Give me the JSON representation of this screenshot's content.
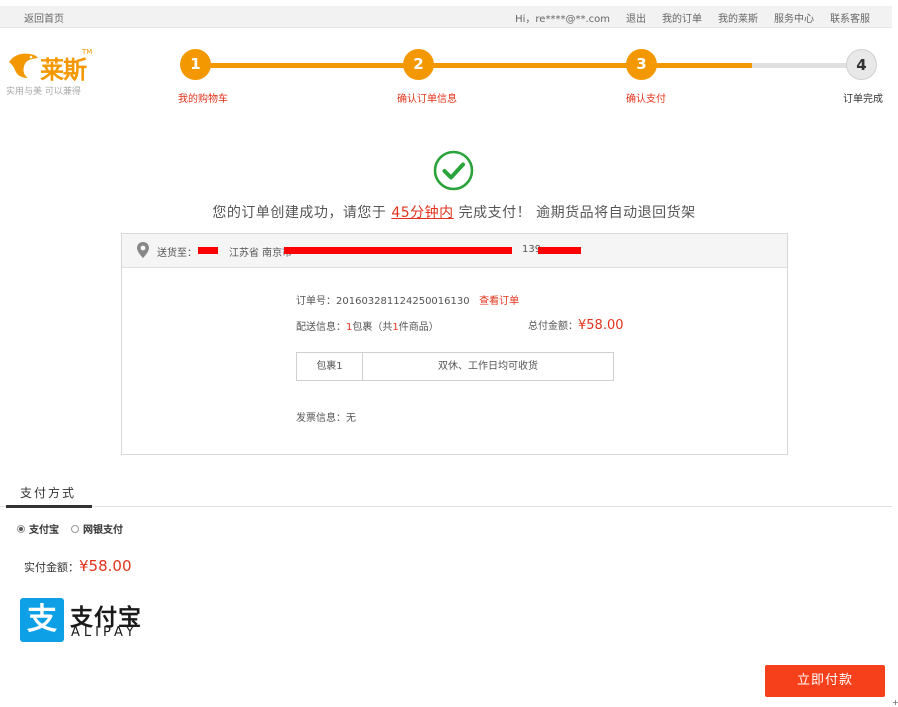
{
  "topbar": {
    "home": "返回首页",
    "greeting": "Hi，",
    "user": "re****@**.com",
    "links": [
      "退出",
      "我的订单",
      "我的莱斯",
      "服务中心",
      "联系客服"
    ]
  },
  "logo": {
    "brand": "莱斯",
    "tm": "TM",
    "slogan": "实用与美 可以兼得"
  },
  "steps": [
    {
      "num": "1",
      "label": "我的购物车"
    },
    {
      "num": "2",
      "label": "确认订单信息"
    },
    {
      "num": "3",
      "label": "确认支付"
    },
    {
      "num": "4",
      "label": "订单完成"
    }
  ],
  "colors": {
    "accent": "#f39800",
    "inactive": "#e0e0e0",
    "red": "#e3331c",
    "success": "#2aa33a",
    "button": "#f5401b",
    "alipay_blue": "#0ea0e6"
  },
  "success": {
    "before": "您的订单创建成功，请您于",
    "limit": "45分钟内",
    "after": "完成支付！ 逾期货品将自动退回货架"
  },
  "order": {
    "ship_label": "送货至：",
    "address": "江苏省 南京市",
    "phone_prefix": "139",
    "order_no_label": "订单号：",
    "order_no": "20160328112425001613​0",
    "view_order": "查看订单",
    "delivery_label": "配送信息：",
    "delivery_count": "1",
    "delivery_mid": "包裹（共",
    "delivery_items": "1",
    "delivery_end": "件商品）",
    "total_label": "总付金额：",
    "total": "¥58.00",
    "package_name": "包裹1",
    "package_time": "双休、工作日均可收货",
    "invoice_label": "发票信息：",
    "invoice": "无"
  },
  "payment": {
    "tab": "支付方式",
    "options": [
      "支付宝",
      "网银支付"
    ],
    "selected": "支付宝",
    "amount_label": "实付金额：",
    "amount": "¥58.00",
    "alipay_cn": "支付宝",
    "alipay_en": "ALIPAY",
    "alipay_mark": "支",
    "pay_button": "立即付款"
  },
  "corner": "+"
}
